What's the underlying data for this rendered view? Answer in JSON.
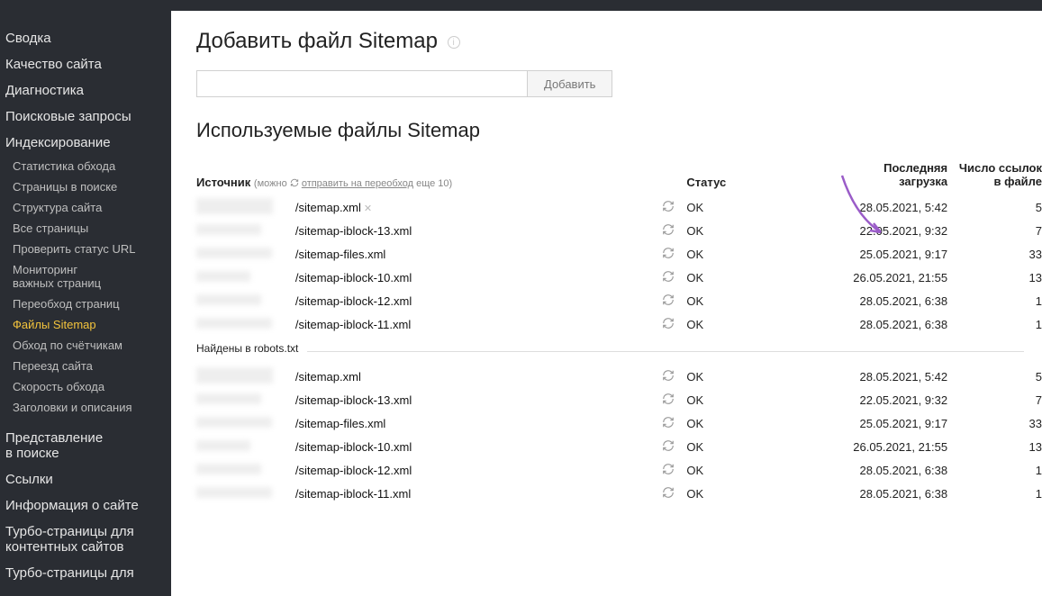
{
  "sidebar": {
    "summary": "Сводка",
    "quality": "Качество сайта",
    "diagnostics": "Диагностика",
    "queries": "Поисковые запросы",
    "indexing": "Индексирование",
    "indexing_items": {
      "crawl_stats": "Статистика обхода",
      "pages_in_search": "Страницы в поиске",
      "site_structure": "Структура сайта",
      "all_pages": "Все страницы",
      "check_url": "Проверить статус URL",
      "monitoring_line1": "Мониторинг",
      "monitoring_line2": "важных страниц",
      "recrawl_pages": "Переобход страниц",
      "sitemap_files": "Файлы Sitemap",
      "counter_crawl": "Обход по счётчикам",
      "site_move": "Переезд сайта",
      "crawl_speed": "Скорость обхода",
      "titles_desc": "Заголовки и описания"
    },
    "presentation_line1": "Представление",
    "presentation_line2": "в поиске",
    "links": "Ссылки",
    "site_info": "Информация о сайте",
    "turbo_content_line1": "Турбо-страницы для",
    "turbo_content_line2": "контентных сайтов",
    "turbo_other_line1": "Турбо-страницы для"
  },
  "main": {
    "add_title": "Добавить файл Sitemap",
    "add_button": "Добавить",
    "used_title": "Используемые файлы Sitemap",
    "headers": {
      "source": "Источник",
      "hint_prefix": "(можно ",
      "hint_link": "отправить на переобход",
      "hint_suffix": " еще 10)",
      "status": "Статус",
      "last_load_line1": "Последняя",
      "last_load_line2": "загрузка",
      "links_count_line1": "Число ссылок",
      "links_count_line2": "в файле"
    },
    "section_robots": "Найдены в robots.txt",
    "rows_primary": [
      {
        "path": "/sitemap.xml",
        "removable": true,
        "status": "OK",
        "date": "28.05.2021, 5:42",
        "links": "5"
      },
      {
        "path": "/sitemap-iblock-13.xml",
        "removable": false,
        "status": "OK",
        "date": "22.05.2021, 9:32",
        "links": "7"
      },
      {
        "path": "/sitemap-files.xml",
        "removable": false,
        "status": "OK",
        "date": "25.05.2021, 9:17",
        "links": "33"
      },
      {
        "path": "/sitemap-iblock-10.xml",
        "removable": false,
        "status": "OK",
        "date": "26.05.2021, 21:55",
        "links": "13"
      },
      {
        "path": "/sitemap-iblock-12.xml",
        "removable": false,
        "status": "OK",
        "date": "28.05.2021, 6:38",
        "links": "1"
      },
      {
        "path": "/sitemap-iblock-11.xml",
        "removable": false,
        "status": "OK",
        "date": "28.05.2021, 6:38",
        "links": "1"
      }
    ],
    "rows_robots": [
      {
        "path": "/sitemap.xml",
        "status": "OK",
        "date": "28.05.2021, 5:42",
        "links": "5"
      },
      {
        "path": "/sitemap-iblock-13.xml",
        "status": "OK",
        "date": "22.05.2021, 9:32",
        "links": "7"
      },
      {
        "path": "/sitemap-files.xml",
        "status": "OK",
        "date": "25.05.2021, 9:17",
        "links": "33"
      },
      {
        "path": "/sitemap-iblock-10.xml",
        "status": "OK",
        "date": "26.05.2021, 21:55",
        "links": "13"
      },
      {
        "path": "/sitemap-iblock-12.xml",
        "status": "OK",
        "date": "28.05.2021, 6:38",
        "links": "1"
      },
      {
        "path": "/sitemap-iblock-11.xml",
        "status": "OK",
        "date": "28.05.2021, 6:38",
        "links": "1"
      }
    ]
  }
}
